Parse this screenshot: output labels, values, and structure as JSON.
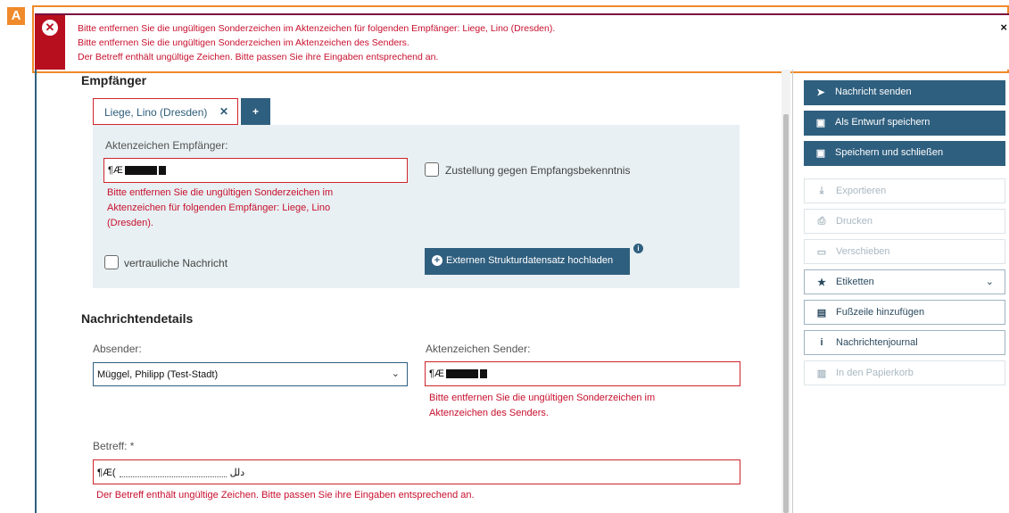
{
  "marker": "A",
  "errors": {
    "lines": [
      "Bitte entfernen Sie die ungültigen Sonderzeichen im Aktenzeichen für folgenden Empfänger: Liege, Lino (Dresden).",
      "Bitte entfernen Sie die ungültigen Sonderzeichen im Aktenzeichen des Senders.",
      "Der Betreff enthält ungültige Zeichen. Bitte passen Sie ihre Eingaben entsprechend an."
    ],
    "close_label": "×"
  },
  "recipients": {
    "heading": "Empfänger",
    "tab_label": "Liege, Lino (Dresden)",
    "tab_close": "✕",
    "add_label": "+",
    "aktenzeichen_label": "Aktenzeichen Empfänger:",
    "aktenzeichen_value": "¶Æ",
    "aktenzeichen_error": [
      "Bitte entfernen Sie die ungültigen Sonderzeichen im",
      "Aktenzeichen für folgenden Empfänger: Liege, Lino",
      "(Dresden)."
    ],
    "zustellung_label": "Zustellung gegen Empfangsbekenntnis",
    "vertraulich_label": "vertrauliche Nachricht",
    "upload_label": "Externen Strukturdatensatz hochladen",
    "upload_icon": "plus-circle-icon",
    "info_icon": "info-icon"
  },
  "details": {
    "heading": "Nachrichtendetails",
    "absender_label": "Absender:",
    "absender_value": "Müggel, Philipp (Test-Stadt)",
    "sender_az_label": "Aktenzeichen Sender:",
    "sender_az_value": "¶Æ",
    "sender_az_error": [
      "Bitte entfernen Sie die ungültigen Sonderzeichen im",
      "Aktenzeichen des Senders."
    ],
    "betreff_label": "Betreff: *",
    "betreff_value_start": "¶Æ(",
    "betreff_value_end": "دلل",
    "betreff_error": "Der Betreff enthält ungültige Zeichen. Bitte passen Sie ihre Eingaben entsprechend an."
  },
  "sidebar": {
    "items": [
      {
        "label": "Nachricht senden",
        "icon": "paper-plane-icon",
        "glyph": "➤",
        "state": "primary"
      },
      {
        "label": "Als Entwurf speichern",
        "icon": "floppy-disk-icon",
        "glyph": "▣",
        "state": "primary"
      },
      {
        "label": "Speichern und schließen",
        "icon": "save-close-icon",
        "glyph": "▣",
        "state": "primary"
      },
      {
        "label": "Exportieren",
        "icon": "download-icon",
        "glyph": "⤓",
        "state": "disabled"
      },
      {
        "label": "Drucken",
        "icon": "printer-icon",
        "glyph": "⎙",
        "state": "disabled"
      },
      {
        "label": "Verschieben",
        "icon": "folder-icon",
        "glyph": "▭",
        "state": "disabled"
      },
      {
        "label": "Etiketten",
        "icon": "tag-icon",
        "glyph": "★",
        "state": "normal"
      },
      {
        "label": "Fußzeile hinzufügen",
        "icon": "document-icon",
        "glyph": "▤",
        "state": "normal"
      },
      {
        "label": "Nachrichtenjournal",
        "icon": "info-icon",
        "glyph": "i",
        "state": "normal"
      },
      {
        "label": "In den Papierkorb",
        "icon": "trash-icon",
        "glyph": "▥",
        "state": "disabled"
      }
    ],
    "etiketten_caret": "⌄"
  }
}
